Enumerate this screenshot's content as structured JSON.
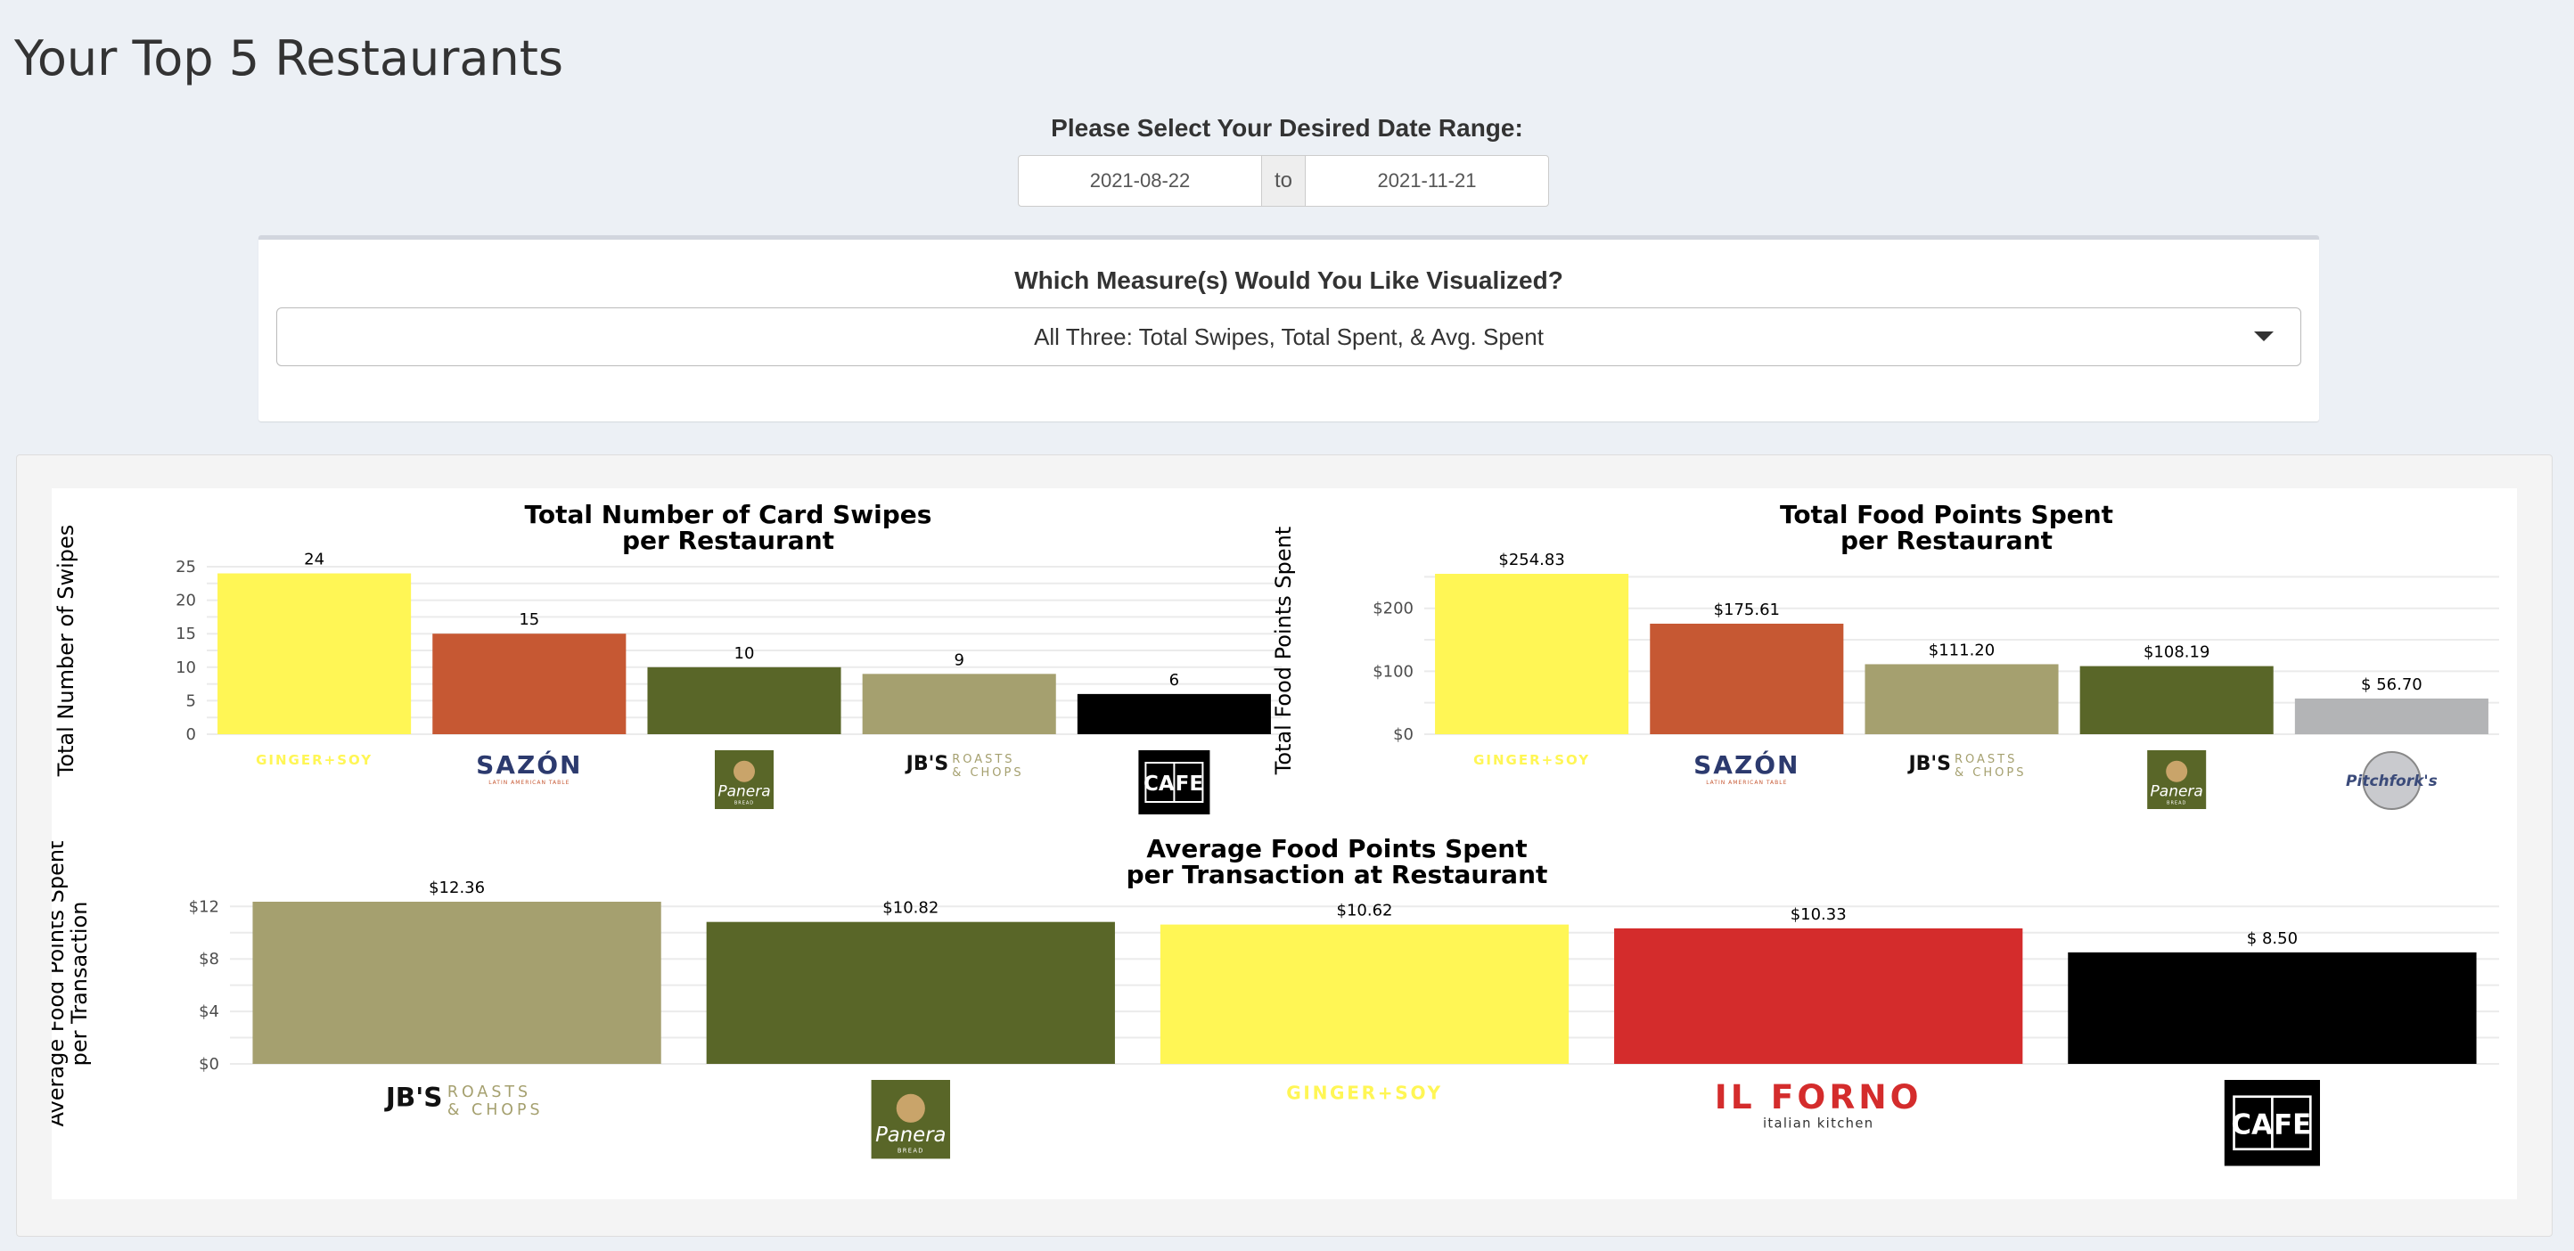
{
  "page": {
    "title": "Your Top 5 Restaurants"
  },
  "date_filter": {
    "label": "Please Select Your Desired Date Range:",
    "start": "2021-08-22",
    "separator": "to",
    "end": "2021-11-21"
  },
  "measure_filter": {
    "label": "Which Measure(s) Would You Like Visualized?",
    "selected": "All Three: Total Swipes, Total Spent, & Avg. Spent"
  },
  "colors": {
    "ginger_soy": "#fff655",
    "sazon": "#c65833",
    "panera": "#596628",
    "jbs": "#a5a06f",
    "cafe": "#000000",
    "pitchforks": "#b3b4b6",
    "il_forno": "#d42c2c"
  },
  "chart_data": [
    {
      "type": "bar",
      "title": "Total Number of Card Swipes\nper Restaurant",
      "ylabel": "Total Number of Swipes",
      "xlabel": "",
      "categories": [
        "GINGER+SOY",
        "SAZÓN",
        "Panera",
        "JB'S ROASTS & CHOPS",
        "CAFE"
      ],
      "values": [
        24,
        15,
        10,
        9,
        6
      ],
      "data_labels": [
        "24",
        "15",
        "10",
        "9",
        "6"
      ],
      "bar_colors": [
        "#fff655",
        "#c65833",
        "#596628",
        "#a5a06f",
        "#000000"
      ],
      "yticks": [
        0,
        5,
        10,
        15,
        20,
        25
      ],
      "ytick_labels": [
        "0",
        "5",
        "10",
        "15",
        "20",
        "25"
      ],
      "ylim": [
        0,
        25
      ]
    },
    {
      "type": "bar",
      "title": "Total Food Points Spent\nper Restaurant",
      "ylabel": "Total Food Points Spent",
      "xlabel": "",
      "categories": [
        "GINGER+SOY",
        "SAZÓN",
        "JB'S ROASTS & CHOPS",
        "Panera",
        "Pitchfork's"
      ],
      "values": [
        254.83,
        175.61,
        111.2,
        108.19,
        56.7
      ],
      "data_labels": [
        "$254.83",
        "$175.61",
        "$111.20",
        "$108.19",
        "$ 56.70"
      ],
      "bar_colors": [
        "#fff655",
        "#c65833",
        "#a5a06f",
        "#596628",
        "#b3b4b6"
      ],
      "yticks": [
        0,
        100,
        200
      ],
      "ytick_labels": [
        "$0",
        "$100",
        "$200"
      ],
      "ylim": [
        0,
        254.83
      ]
    },
    {
      "type": "bar",
      "title": "Average Food Points Spent\nper Transaction at Restaurant",
      "ylabel": "Average Food Points Spent\nper Transaction",
      "xlabel": "",
      "categories": [
        "JB'S ROASTS & CHOPS",
        "Panera",
        "GINGER+SOY",
        "IL FORNO",
        "CAFE"
      ],
      "values": [
        12.36,
        10.82,
        10.62,
        10.33,
        8.5
      ],
      "data_labels": [
        "$12.36",
        "$10.82",
        "$10.62",
        "$10.33",
        "$ 8.50"
      ],
      "bar_colors": [
        "#a5a06f",
        "#596628",
        "#fff655",
        "#d42c2c",
        "#000000"
      ],
      "yticks": [
        0,
        4,
        8,
        12
      ],
      "ytick_labels": [
        "$0",
        "$4",
        "$8",
        "$12"
      ],
      "ylim": [
        0,
        12.36
      ]
    }
  ],
  "logos": {
    "ginger_soy": "GINGER+SOY",
    "sazon": "SAZÓN",
    "sazon_sub": "LATIN AMERICAN TABLE",
    "panera": "Panera",
    "panera_sub": "BREAD",
    "jbs_mark": "JB'S",
    "jbs_line1": "ROASTS",
    "jbs_line2": "& CHOPS",
    "cafe_a": "CA",
    "cafe_b": "FE",
    "pitchforks": "Pitchfork's",
    "il_forno": "IL FORNO",
    "il_forno_sub": "italian kitchen"
  }
}
